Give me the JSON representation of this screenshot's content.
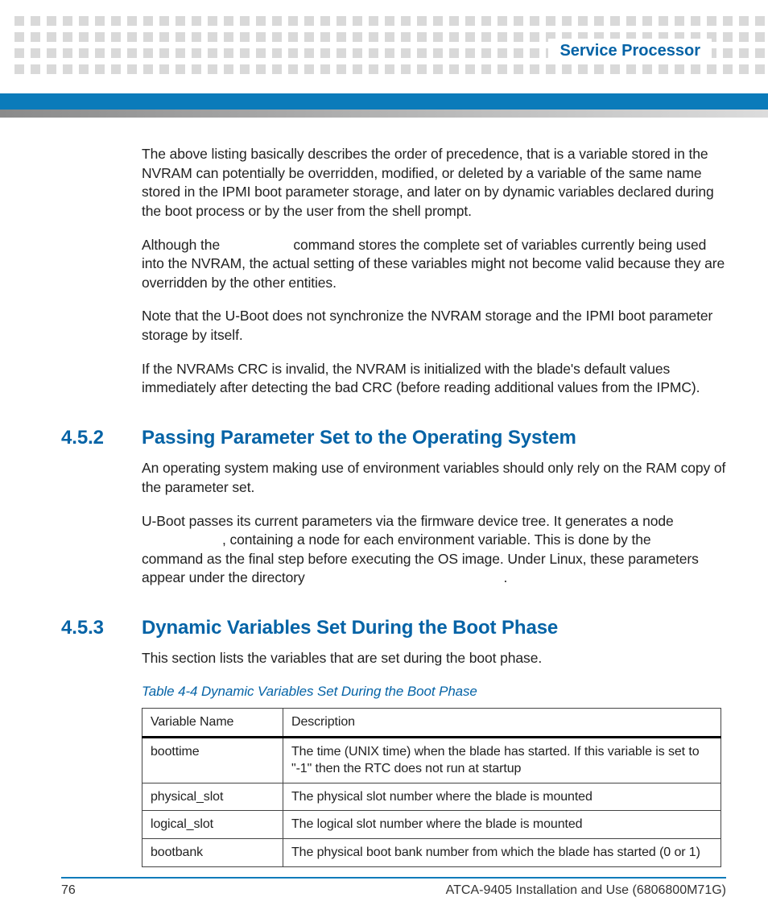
{
  "header": {
    "label": "Service Processor"
  },
  "paragraphs": {
    "p1": "The above listing basically describes the order of precedence, that is a variable stored in the NVRAM can potentially be overridden, modified, or deleted by a variable of the same name stored in the IPMI boot parameter storage, and later on by dynamic variables declared during the boot process or by the user from the shell prompt.",
    "p2a": "Although the ",
    "p2b": " command stores the complete set of variables currently being used into the NVRAM, the actual setting of these variables might not become valid because they are overridden by the other entities.",
    "p3": "Note that the U-Boot does not synchronize the NVRAM storage and the IPMI boot parameter storage by itself.",
    "p4": "If the NVRAMs CRC is invalid, the NVRAM is initialized with the blade's default values immediately after detecting the bad CRC (before reading additional values from the IPMC)."
  },
  "sec452": {
    "num": "4.5.2",
    "title": "Passing Parameter Set to the Operating System",
    "p1": "An operating system making use of environment variables should only rely on the RAM copy of the parameter set.",
    "p2a": "U-Boot passes its current parameters via the firmware device tree. It generates a node ",
    "p2b": ", containing a node for each environment variable. This is done by the ",
    "p2c": " command as the final step before executing the OS image. Under Linux, these parameters appear under the directory ",
    "p2d": "."
  },
  "sec453": {
    "num": "4.5.3",
    "title": "Dynamic Variables Set During the Boot Phase",
    "p1": "This section lists the variables that are set during the boot phase."
  },
  "table": {
    "caption": "Table 4-4 Dynamic Variables Set During the Boot Phase",
    "headers": {
      "c1": "Variable Name",
      "c2": "Description"
    },
    "rows": [
      {
        "name": "boottime",
        "desc": "The time (UNIX time) when the blade has started. If this variable is set to \"-1\" then the RTC does not run at startup"
      },
      {
        "name": "physical_slot",
        "desc": "The physical slot number where the blade is mounted"
      },
      {
        "name": "logical_slot",
        "desc": "The logical slot number where the blade is mounted"
      },
      {
        "name": "bootbank",
        "desc": "The physical boot bank number from which the blade has started (0 or 1)"
      }
    ]
  },
  "footer": {
    "page": "76",
    "doc": "ATCA-9405 Installation and Use (6806800M71G)"
  }
}
